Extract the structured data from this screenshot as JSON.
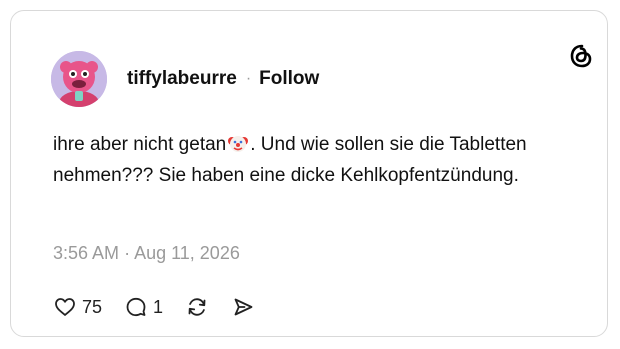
{
  "post": {
    "username": "tiffylabeurre",
    "separator": "·",
    "follow_label": "Follow",
    "text_before_emoji": "ihre aber nicht getan",
    "emoji": "clown-face",
    "text_after_emoji": ". Und wie sollen sie die Tabletten nehmen??? Sie haben eine dicke Kehlkopfentzündung.",
    "time": "3:56 AM",
    "date": "Aug 11, 2026",
    "meta_separator": "·"
  },
  "actions": {
    "likes": "75",
    "replies": "1"
  },
  "icons": [
    "threads-logo-icon",
    "heart-icon",
    "reply-icon",
    "repost-icon",
    "share-icon"
  ],
  "colors": {
    "text": "#111111",
    "muted": "#9a9a9a",
    "border": "#d9d9d9",
    "avatar_bg": "#c7b9e6"
  }
}
